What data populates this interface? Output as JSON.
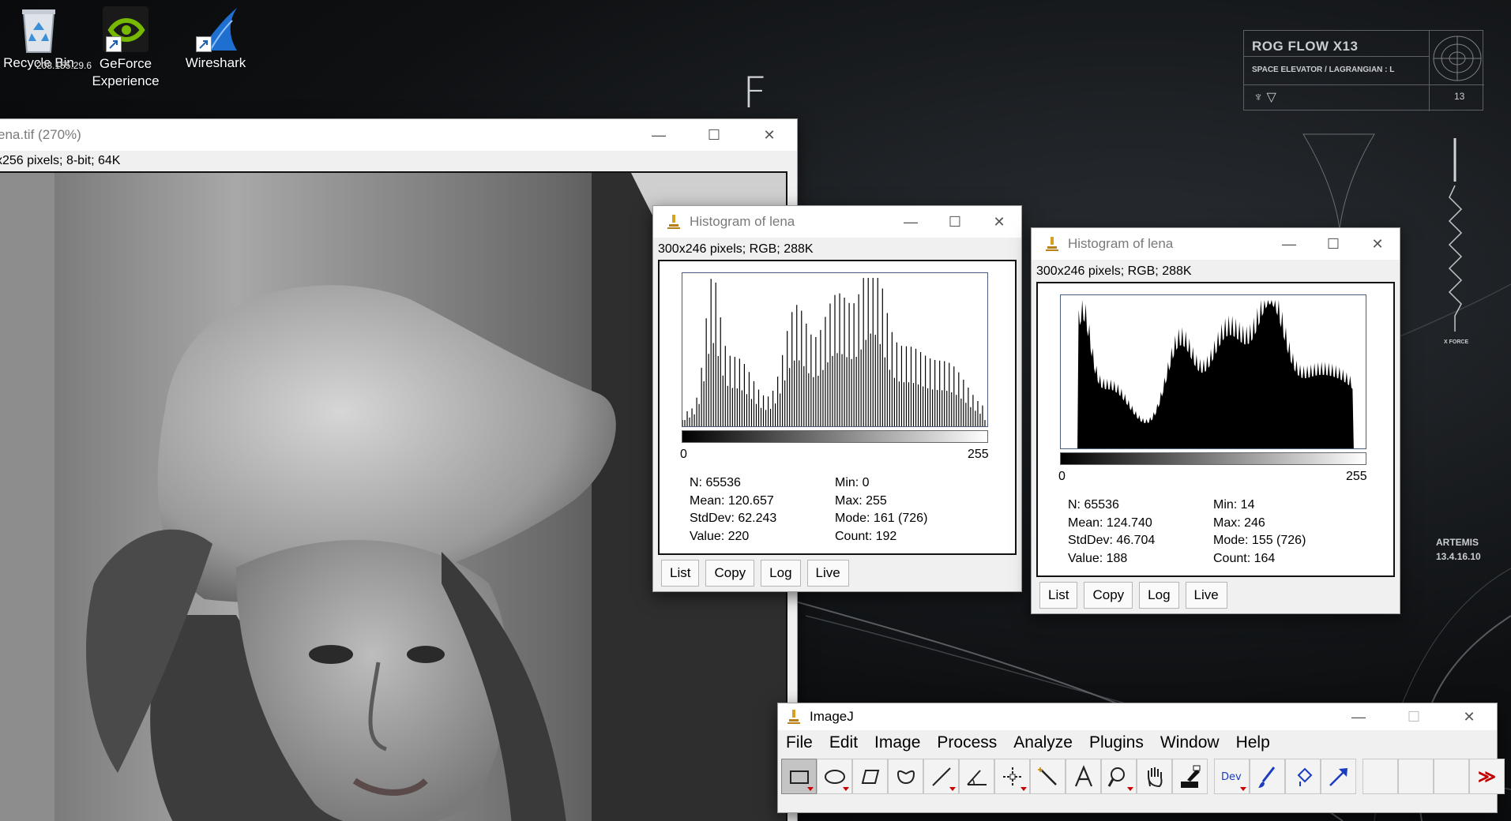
{
  "desktop": {
    "icons": [
      {
        "label": "Recycle Bin"
      },
      {
        "label": "GeForce Experience"
      },
      {
        "label": "Wireshark"
      }
    ],
    "ip_overlay": "208.155.29.6",
    "brand_letter": "F",
    "rog": {
      "title": "ROG FLOW X13",
      "subtitle": "SPACE ELEVATOR / LAGRANGIAN : L",
      "number": "13"
    },
    "xforce_label": "X FORCE",
    "artemis": {
      "name": "ARTEMIS",
      "version": "13.4.16.10"
    }
  },
  "image_window": {
    "title": "ena.tif (270%)",
    "info": "x256 pixels; 8-bit; 64K"
  },
  "histograms": [
    {
      "title": "Histogram of lena",
      "info": "300x246 pixels; RGB; 288K",
      "axis_min": "0",
      "axis_max": "255",
      "style": "bars",
      "stats_left": [
        "N: 65536",
        "Mean: 120.657",
        "StdDev: 62.243",
        "Value: 220"
      ],
      "stats_right": [
        "Min: 0",
        "Max: 255",
        "Mode: 161 (726)",
        "Count: 192"
      ],
      "buttons": [
        "List",
        "Copy",
        "Log",
        "Live"
      ]
    },
    {
      "title": "Histogram of lena",
      "info": "300x246 pixels; RGB; 288K",
      "axis_min": "0",
      "axis_max": "255",
      "style": "filled",
      "stats_left": [
        "N: 65536",
        "Mean: 124.740",
        "StdDev: 46.704",
        "Value: 188"
      ],
      "stats_right": [
        "Min: 14",
        "Max: 246",
        "Mode: 155 (726)",
        "Count: 164"
      ],
      "buttons": [
        "List",
        "Copy",
        "Log",
        "Live"
      ]
    }
  ],
  "imagej": {
    "title": "ImageJ",
    "menu": [
      "File",
      "Edit",
      "Image",
      "Process",
      "Analyze",
      "Plugins",
      "Window",
      "Help"
    ],
    "tools": [
      {
        "name": "rectangle-tool-icon",
        "selected": true,
        "has_menu": true
      },
      {
        "name": "oval-tool-icon",
        "has_menu": true
      },
      {
        "name": "polygon-tool-icon"
      },
      {
        "name": "freehand-tool-icon"
      },
      {
        "name": "line-tool-icon",
        "has_menu": true
      },
      {
        "name": "angle-tool-icon"
      },
      {
        "name": "point-tool-icon",
        "has_menu": true
      },
      {
        "name": "wand-tool-icon"
      },
      {
        "name": "text-tool-icon"
      },
      {
        "name": "magnifier-tool-icon",
        "has_menu": true
      },
      {
        "name": "hand-tool-icon"
      },
      {
        "name": "color-picker-tool-icon"
      },
      {
        "name": "dev-menu-icon",
        "label": "Dev",
        "has_menu": true
      },
      {
        "name": "brush-tool-icon"
      },
      {
        "name": "flood-fill-tool-icon"
      },
      {
        "name": "arrow-tool-icon"
      },
      {
        "name": "empty-slot-1"
      },
      {
        "name": "empty-slot-2"
      },
      {
        "name": "empty-slot-3"
      },
      {
        "name": "more-tools-icon",
        "label": "≫"
      }
    ],
    "accent": "#c00000"
  }
}
